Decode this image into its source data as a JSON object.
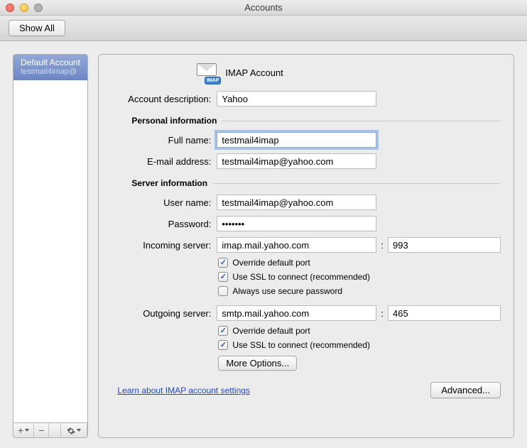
{
  "window": {
    "title": "Accounts"
  },
  "toolbar": {
    "showAll": "Show All"
  },
  "sidebar": {
    "accountTitle": "Default Account",
    "accountSub": "testmail4imap@"
  },
  "header": {
    "iconBadge": "IMAP",
    "typeLabel": "IMAP Account"
  },
  "labels": {
    "description": "Account description:",
    "personalInfo": "Personal information",
    "fullName": "Full name:",
    "email": "E-mail address:",
    "serverInfo": "Server information",
    "userName": "User name:",
    "password": "Password:",
    "incoming": "Incoming server:",
    "outgoing": "Outgoing server:"
  },
  "values": {
    "description": "Yahoo",
    "fullName": "testmail4imap",
    "email": "testmail4imap@yahoo.com",
    "userName": "testmail4imap@yahoo.com",
    "password": "•••••••",
    "incomingServer": "imap.mail.yahoo.com",
    "incomingPort": "993",
    "outgoingServer": "smtp.mail.yahoo.com",
    "outgoingPort": "465"
  },
  "checks": {
    "incoming": {
      "overridePort": {
        "label": "Override default port",
        "checked": true
      },
      "useSSL": {
        "label": "Use SSL to connect (recommended)",
        "checked": true
      },
      "securePwd": {
        "label": "Always use secure password",
        "checked": false
      }
    },
    "outgoing": {
      "overridePort": {
        "label": "Override default port",
        "checked": true
      },
      "useSSL": {
        "label": "Use SSL to connect (recommended)",
        "checked": true
      }
    }
  },
  "buttons": {
    "moreOptions": "More Options...",
    "advanced": "Advanced..."
  },
  "link": "Learn about IMAP account settings",
  "footerIcons": {
    "add": "+",
    "remove": "−"
  }
}
